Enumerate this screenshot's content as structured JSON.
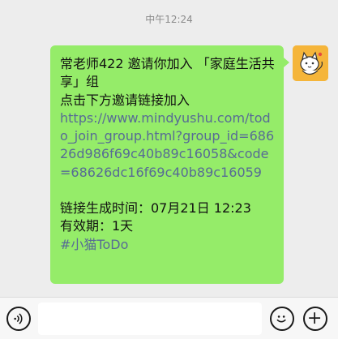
{
  "chat": {
    "timestamp": "中午12:24",
    "message": {
      "line1": "常老师422 邀请你加入 「家庭生活共享」组",
      "line2": "点击下方邀请链接加入",
      "link": "https://www.mindyushu.com/todo_join_group.html?group_id=68626d986f69c40b89c16058&code=68626dc16f69c40b89c16059",
      "created": "链接生成时间：07月21日 12:23",
      "validity": "有效期：1天",
      "tag": "#小猫ToDo"
    }
  },
  "input_bar": {
    "voice_icon": "voice-icon",
    "emoji_icon": "emoji-icon",
    "plus_icon": "plus-icon"
  }
}
